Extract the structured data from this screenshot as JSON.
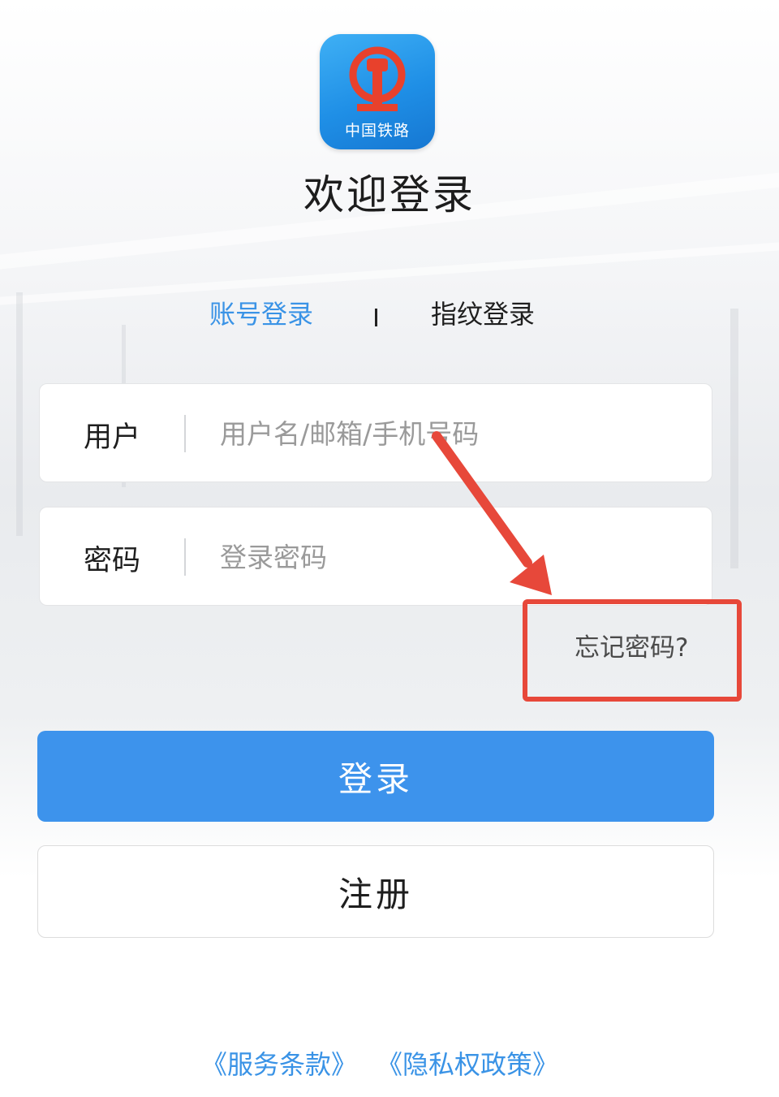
{
  "app": {
    "logo_text": "中国铁路",
    "welcome_title": "欢迎登录"
  },
  "tabs": {
    "account_login": "账号登录",
    "fingerprint_login": "指纹登录",
    "active": "account_login",
    "active_color": "#3a93e6"
  },
  "form": {
    "user_label": "用户",
    "user_placeholder": "用户名/邮箱/手机号码",
    "user_value": "",
    "password_label": "密码",
    "password_placeholder": "登录密码",
    "password_value": "",
    "forgot_password": "忘记密码?"
  },
  "buttons": {
    "login_label": "登录",
    "login_color": "#3d93ec",
    "register_label": "注册"
  },
  "footer": {
    "terms_link": "《服务条款》",
    "privacy_link": "《隐私权政策》"
  },
  "annotation": {
    "highlight_color": "#e7483a",
    "icons": [
      "railway-logo-icon",
      "red-arrow-icon"
    ]
  }
}
